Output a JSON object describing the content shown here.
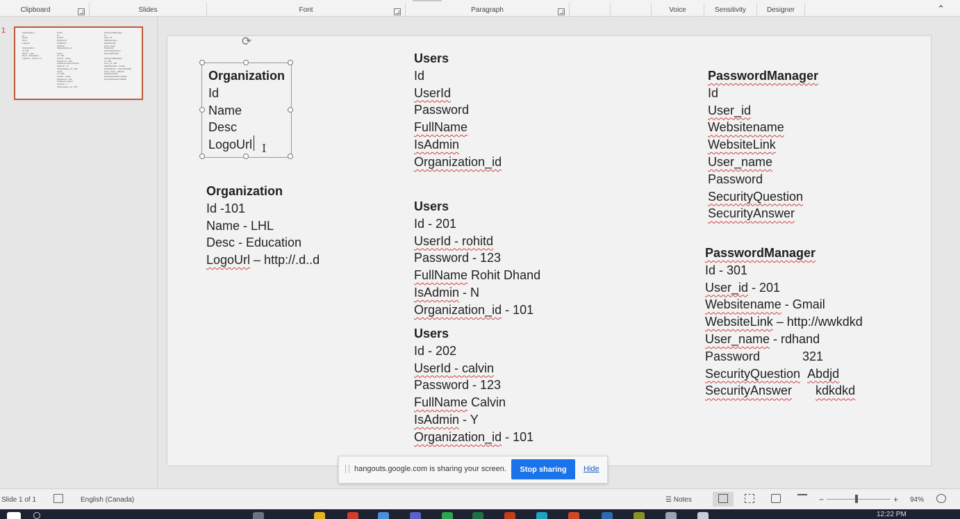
{
  "ribbon": {
    "groups": [
      "Clipboard",
      "Slides",
      "Font",
      "Paragraph",
      "Voice",
      "Sensitivity",
      "Designer"
    ]
  },
  "thumbnail": {
    "slide_number": "1",
    "columns": [
      "Organization\nId\nName\nDesc\nLogoUrl\n\nOrganization\nId -101\nName - LHL\nDesc - Education\nLogoUrl – http://.d..d",
      "Users\nId\nUserId\nPassword\nFullName\nIsAdmin\nOrganization_id\n\nUsers\nId - 201\nUserId - rohitd\nPassword - 123\nFullName Rohit Dhand\nIsAdmin - N\nOrganization_id - 101\nUsers\nId - 202\nUserId - calvin\nPassword - 123\nFullName Calvin\nIsAdmin - Y\nOrganization_id - 101",
      "PasswordManager\nId\nUser_id\nWebsitename\nWebsiteLink\nUser_name\nPassword\nSecurityQuestion\nSecurityAnswer\n\nPasswordManager\nId - 301\nUser_id - 201\nWebsitename - Gmail\nWebsiteLink – http://wwkdkd\nUser_name - rdhand\nPassword 321\nSecurityQuestion Abdjd\nSecurityAnswer kdkdkd"
    ]
  },
  "slide": {
    "org_schema": {
      "title": "Organization",
      "lines": [
        "Id",
        "Name",
        "Desc",
        "LogoUrl"
      ]
    },
    "org_record": {
      "title": "Organization",
      "id": "Id  -101",
      "name": "Name - LHL",
      "desc": "Desc - Education",
      "logo_key": "LogoUrl",
      "logo_val": " – http://.d..d"
    },
    "users_schema": {
      "title": "Users",
      "id": "Id",
      "userid": "UserId",
      "password": "Password",
      "fullname": "FullName",
      "isadmin": "IsAdmin",
      "orgid": "Organization_id"
    },
    "users_record1": {
      "title": "Users",
      "id": "Id - 201",
      "userid_key": "UserId",
      "userid_val": " - rohitd",
      "password": "Password - 123",
      "fullname_key": "FullName",
      "fullname_val": " Rohit Dhand",
      "isadmin_key": "IsAdmin",
      "isadmin_val": " - N",
      "orgid_key": "Organization_id",
      "orgid_val": " - 101"
    },
    "users_record2": {
      "title": "Users",
      "id": "Id - 202",
      "userid_key": "UserId",
      "userid_val": " - calvin",
      "password": "Password - 123",
      "fullname_key": "FullName",
      "fullname_val": " Calvin",
      "isadmin_key": "IsAdmin",
      "isadmin_val": " - Y",
      "orgid_key": "Organization_id",
      "orgid_val": " - 101"
    },
    "pm_schema": {
      "title": "PasswordManager",
      "id": "Id",
      "user_id": "User_id",
      "websitename": "Websitename",
      "websitelink": "WebsiteLink",
      "user_name": "User_name",
      "password": "Password",
      "secq": "SecurityQuestion",
      "seca": "SecurityAnswer"
    },
    "pm_record": {
      "title": "PasswordManager",
      "id": "Id - 301",
      "user_id_key": "User_id",
      "user_id_val": " - 201",
      "websitename_key": "Websitename",
      "websitename_val": " - Gmail",
      "websitelink_key": "WebsiteLink",
      "websitelink_val": " – http://wwkdkd",
      "user_name_key": "User_name",
      "user_name_val": "  - rdhand",
      "password_key": "Password",
      "password_val": "321",
      "secq_key": "SecurityQuestion",
      "secq_val": "Abdjd",
      "seca_key": "SecurityAnswer",
      "seca_val": "kdkdkd"
    }
  },
  "share_banner": {
    "message": "hangouts.google.com is sharing your screen.",
    "stop_label": "Stop sharing",
    "hide_label": "Hide"
  },
  "status": {
    "slide_info": "Slide 1 of 1",
    "language": "English (Canada)",
    "notes_label": "Notes",
    "zoom_minus": "−",
    "zoom_plus": "+",
    "zoom_level": "94%"
  },
  "taskbar": {
    "time": "12:22 PM"
  },
  "colors": {
    "accent": "#c0573a",
    "share_button": "#1a73e8",
    "spell_squiggle": "#d04040"
  }
}
